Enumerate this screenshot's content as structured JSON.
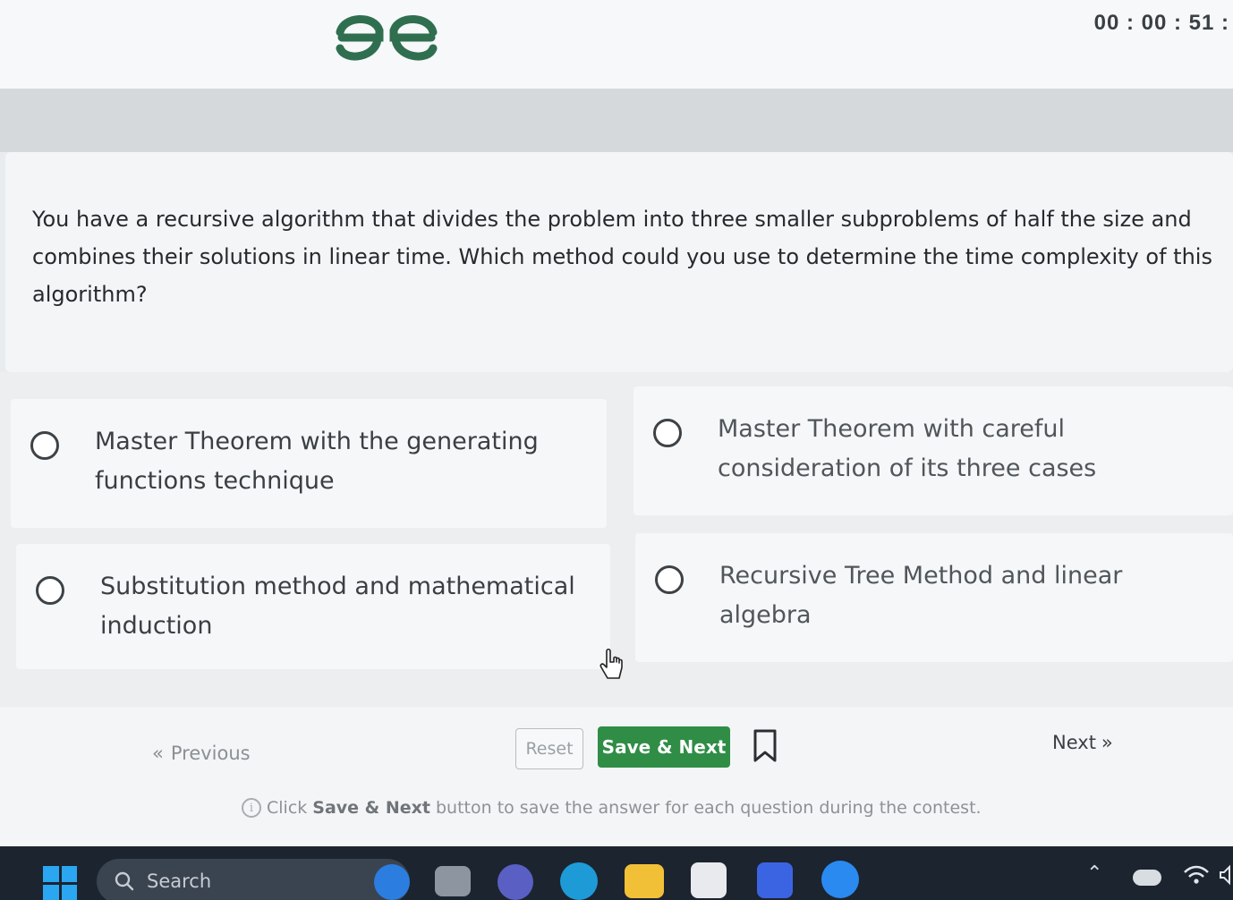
{
  "header": {
    "logo": "gfg-logo",
    "timer": "00 : 00 : 51 :"
  },
  "question": {
    "text": "You have a recursive algorithm that divides the problem into three smaller subproblems of half the size and combines their solutions in linear time. Which method could you use to determine the time complexity of this algorithm?"
  },
  "options": [
    {
      "label": "Master Theorem with the generating functions technique",
      "selected": false
    },
    {
      "label": "Master Theorem with careful consideration of its three cases",
      "selected": false
    },
    {
      "label": "Substitution method and mathematical induction",
      "selected": false
    },
    {
      "label": "Recursive Tree Method and linear algebra",
      "selected": false
    }
  ],
  "footer": {
    "previous_label": "Previous",
    "reset_label": "Reset",
    "save_next_label": "Save & Next",
    "next_label": "Next",
    "info_prefix": "Click",
    "info_bold": "Save & Next",
    "info_suffix": "button to save the answer for each question during the contest."
  },
  "taskbar": {
    "search_placeholder": "Search",
    "apps": [
      "bing-icon",
      "taskview-icon",
      "teams-icon",
      "edge-icon",
      "file-explorer-icon",
      "store-icon",
      "app-icon",
      "media-player-icon"
    ],
    "tray": [
      "chevron-up-icon",
      "onedrive-icon",
      "wifi-icon",
      "volume-icon"
    ]
  },
  "colors": {
    "brand_green": "#2f8d46",
    "logo_green": "#2f6f4f",
    "text_dark": "#262a2e",
    "taskbar_bg": "#1c2430"
  }
}
